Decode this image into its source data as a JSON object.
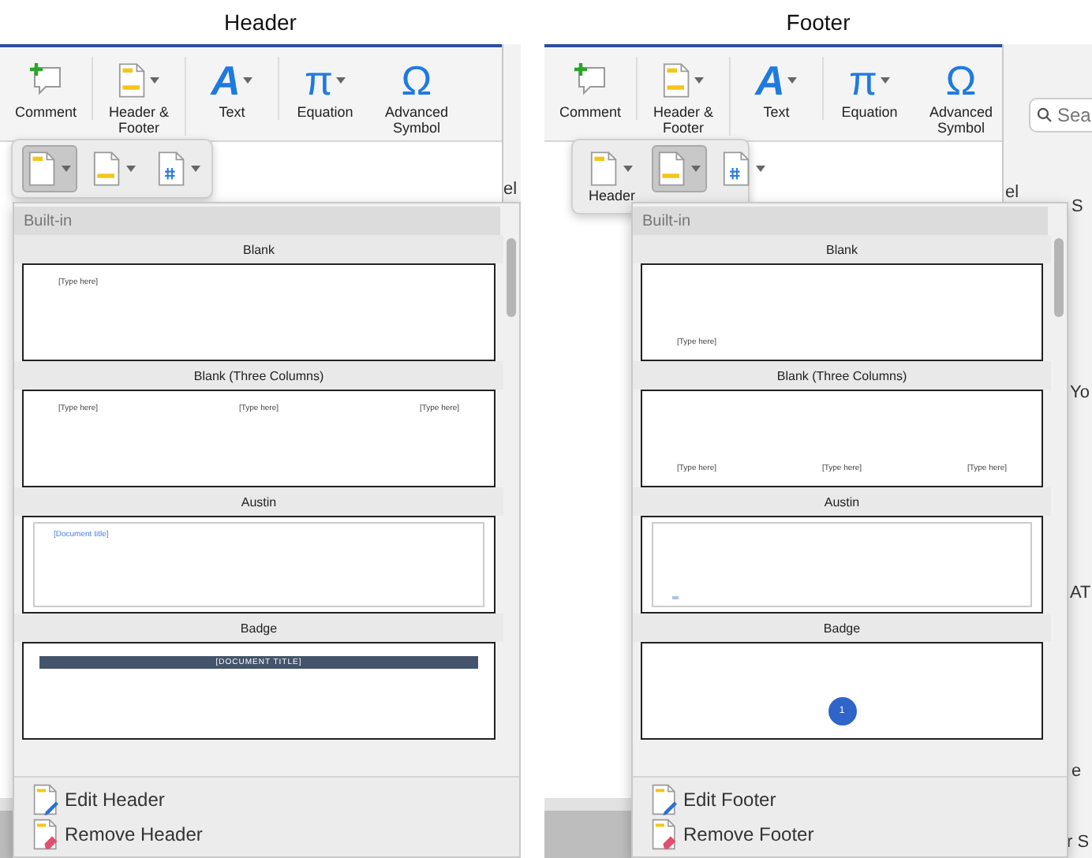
{
  "panels": [
    {
      "caption": "Header",
      "kind": "header",
      "ribbon": [
        {
          "kind": "comment",
          "label": "Comment",
          "menu": false
        },
        {
          "kind": "page",
          "label": "Header & Footer",
          "menu": true
        },
        {
          "kind": "glyph",
          "glyph": "A",
          "label": "Text",
          "menu": true
        },
        {
          "kind": "glyph",
          "glyph": "π",
          "label": "Equation",
          "menu": true
        },
        {
          "kind": "glyph",
          "glyph": "Ω",
          "label": "Advanced Symbol",
          "menu": false
        }
      ],
      "menu_buttons": [
        {
          "kind": "header",
          "selected": true
        },
        {
          "kind": "footer",
          "selected": false
        },
        {
          "kind": "page_number",
          "selected": false
        }
      ],
      "gallery": {
        "title": "Built-in",
        "items": [
          {
            "name": "Blank",
            "kind": "blank",
            "texts": [
              "[Type here]"
            ]
          },
          {
            "name": "Blank (Three Columns)",
            "kind": "columns",
            "texts": [
              "[Type here]",
              "[Type here]",
              "[Type here]"
            ]
          },
          {
            "name": "Austin",
            "kind": "framed",
            "texts": [
              "[Document title]"
            ]
          },
          {
            "name": "Badge",
            "kind": "bar",
            "texts": [
              "[DOCUMENT TITLE]"
            ]
          }
        ]
      },
      "actions": [
        {
          "kind": "edit",
          "label": "Edit Header"
        },
        {
          "kind": "remove",
          "label": "Remove Header"
        }
      ],
      "background": {
        "fragments": [
          "el"
        ]
      }
    },
    {
      "caption": "Footer",
      "kind": "footer",
      "ribbon": [
        {
          "kind": "comment",
          "label": "Comment",
          "menu": false
        },
        {
          "kind": "page",
          "label": "Header & Footer",
          "menu": true
        },
        {
          "kind": "glyph",
          "glyph": "A",
          "label": "Text",
          "menu": true
        },
        {
          "kind": "glyph",
          "glyph": "π",
          "label": "Equation",
          "menu": true
        },
        {
          "kind": "glyph",
          "glyph": "Ω",
          "label": "Advanced Symbol",
          "menu": false
        }
      ],
      "menu_buttons": [
        {
          "kind": "header",
          "selected": false,
          "label": "Header"
        },
        {
          "kind": "footer",
          "selected": true
        },
        {
          "kind": "page_number",
          "selected": false
        }
      ],
      "gallery": {
        "title": "Built-in",
        "items": [
          {
            "name": "Blank",
            "kind": "blank",
            "texts": [
              "[Type here]"
            ]
          },
          {
            "name": "Blank (Three Columns)",
            "kind": "columns",
            "texts": [
              "[Type here]",
              "[Type here]",
              "[Type here]"
            ]
          },
          {
            "name": "Austin",
            "kind": "framed"
          },
          {
            "name": "Badge",
            "kind": "circle",
            "texts": [
              "1"
            ]
          }
        ]
      },
      "actions": [
        {
          "kind": "edit",
          "label": "Edit Footer"
        },
        {
          "kind": "remove",
          "label": "Remove Footer"
        }
      ],
      "background": {
        "search_placeholder": "Sea",
        "fragments": [
          "el",
          "S",
          "Yo",
          "AT",
          "e",
          "r S"
        ]
      }
    }
  ]
}
